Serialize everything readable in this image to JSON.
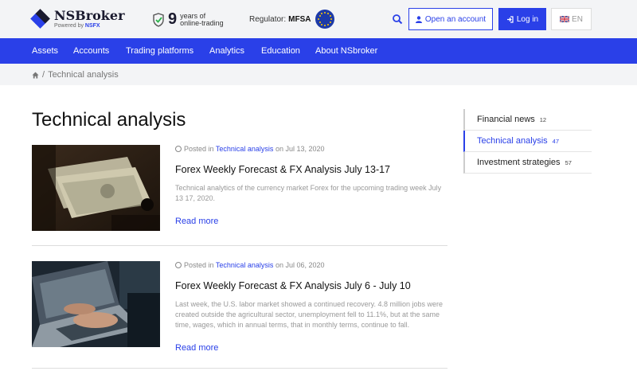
{
  "header": {
    "logo_name": "NSBroker",
    "logo_sub_prefix": "Powered by",
    "logo_sub_brand": "NSFX",
    "years_num": "9",
    "years_line1": "years of",
    "years_line2": "online-trading",
    "regulator_label": "Regulator:",
    "regulator_value": "MFSA",
    "open_account": "Open an account",
    "login": "Log in",
    "language": "EN"
  },
  "nav": {
    "items": [
      "Assets",
      "Accounts",
      "Trading platforms",
      "Analytics",
      "Education",
      "About NSbroker"
    ]
  },
  "breadcrumb": {
    "separator": "/",
    "current": "Technical analysis"
  },
  "page": {
    "title": "Technical analysis"
  },
  "posts": [
    {
      "meta_prefix": "Posted in",
      "category": "Technical analysis",
      "date_prefix": "on",
      "date": "Jul 13, 2020",
      "title": "Forex Weekly Forecast & FX Analysis July 13-17",
      "excerpt": "Technical analytics of the currency market Forex for the upcoming trading week July 13 17, 2020.",
      "read_more": "Read more",
      "image": "money-photo"
    },
    {
      "meta_prefix": "Posted in",
      "category": "Technical analysis",
      "date_prefix": "on",
      "date": "Jul 06, 2020",
      "title": "Forex Weekly Forecast & FX Analysis July 6 - July 10",
      "excerpt": "Last week, the U.S. labor market showed a continued recovery. 4.8 million jobs were created outside the agricultural sector, unemployment fell to 11.1%, but at the same time, wages, which in annual terms, that in monthly terms, continue to fall.",
      "read_more": "Read more",
      "image": "laptop-photo"
    }
  ],
  "sidebar": {
    "items": [
      {
        "label": "Financial news",
        "count": "12"
      },
      {
        "label": "Technical analysis",
        "count": "47"
      },
      {
        "label": "Investment strategies",
        "count": "57"
      }
    ]
  },
  "colors": {
    "brand": "#2a40e8",
    "header_bg": "#f3f4f6"
  }
}
